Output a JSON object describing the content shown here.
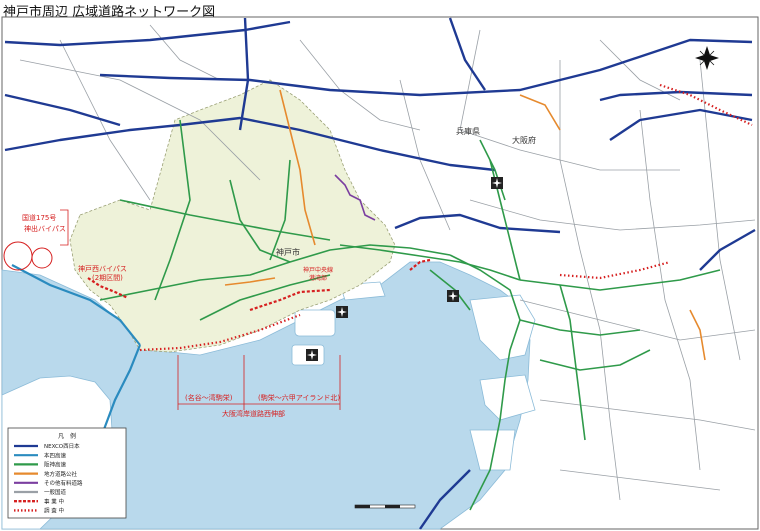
{
  "title": "神戸市周辺 広域道路ネットワーク図",
  "places": {
    "hyogo": "兵庫県",
    "osaka": "大阪府",
    "kobe": "神戸市"
  },
  "annotations": {
    "route175": "国道175号",
    "kande_bypass": "神出バイパス",
    "kobe_nishi_bypass": "神戸西バイパス",
    "kobe_nishi_bypass_sub": "(2期区間)",
    "kobe_central_line": "神戸中央線",
    "kobe_central_sub": "港湾部",
    "span_west": "(名谷～湾駒栄)",
    "span_east": "(駒栄～六甲アイランド北)",
    "osaka_bay_west": "大阪湾岸道路西伸部"
  },
  "legend": {
    "title": "凡　例",
    "items": [
      {
        "label": "NEXCO西日本",
        "color": "#1f3a93",
        "style": "solid"
      },
      {
        "label": "本四高速",
        "color": "#2a8bbf",
        "style": "solid"
      },
      {
        "label": "阪神高速",
        "color": "#2f9a4a",
        "style": "solid"
      },
      {
        "label": "地方道路公社",
        "color": "#e68a2e",
        "style": "solid"
      },
      {
        "label": "その他有料道路",
        "color": "#7b3fa0",
        "style": "solid"
      },
      {
        "label": "一般国道",
        "color": "#9aa0a6",
        "style": "solid"
      },
      {
        "label": "事 業 中",
        "color": "#d62020",
        "style": "dashed"
      },
      {
        "label": "調 査 中",
        "color": "#d62020",
        "style": "dotted"
      }
    ]
  },
  "colors": {
    "sea": "#b9d9ec",
    "land": "#ffffff",
    "kobe_area": "#eef2d9",
    "nexco": "#1f3a93",
    "honshi": "#2a8bbf",
    "hanshin": "#2f9a4a",
    "public": "#e68a2e",
    "other_toll": "#7b3fa0",
    "national": "#9aa0a6",
    "planned": "#d62020"
  },
  "icons": {
    "compass": "north-arrow-icon",
    "airport": "airplane-icon"
  }
}
